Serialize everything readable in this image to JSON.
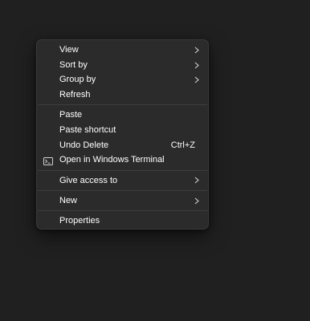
{
  "context_menu": {
    "groups": [
      {
        "items": [
          {
            "label": "View",
            "submenu": true
          },
          {
            "label": "Sort by",
            "submenu": true
          },
          {
            "label": "Group by",
            "submenu": true
          },
          {
            "label": "Refresh",
            "submenu": false
          }
        ]
      },
      {
        "items": [
          {
            "label": "Paste",
            "submenu": false
          },
          {
            "label": "Paste shortcut",
            "submenu": false
          },
          {
            "label": "Undo Delete",
            "shortcut": "Ctrl+Z"
          },
          {
            "label": "Open in Windows Terminal",
            "icon": "terminal-icon"
          }
        ]
      },
      {
        "items": [
          {
            "label": "Give access to",
            "submenu": true
          }
        ]
      },
      {
        "items": [
          {
            "label": "New",
            "submenu": true
          }
        ]
      },
      {
        "items": [
          {
            "label": "Properties",
            "submenu": false
          }
        ]
      }
    ]
  }
}
